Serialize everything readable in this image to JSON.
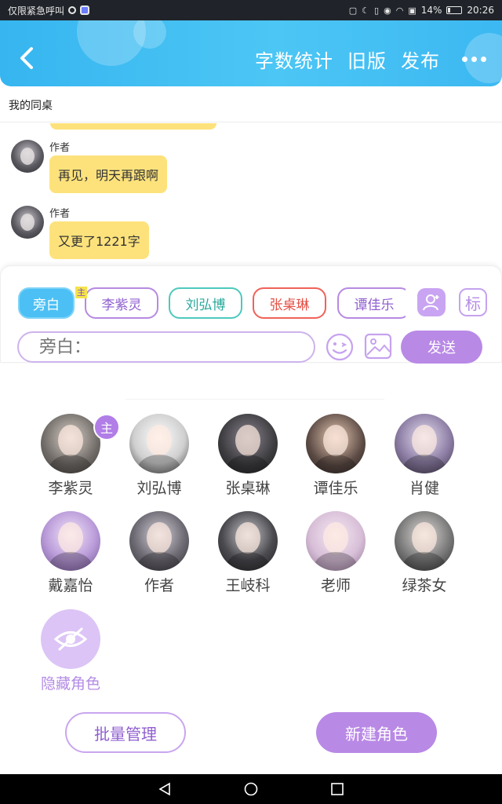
{
  "status_bar": {
    "left_text": "仅限紧急呼叫",
    "battery_text": "14%",
    "battery_level": 0.14,
    "time": "20:26"
  },
  "header": {
    "actions": [
      "字数统计",
      "旧版",
      "发布"
    ]
  },
  "chat": {
    "title": "我的同桌",
    "messages": [
      {
        "sender": "作者",
        "text": "再见，明天再跟啊"
      },
      {
        "sender": "作者",
        "text": "又更了1221字"
      }
    ]
  },
  "input": {
    "role_chips": [
      "旁白",
      "李紫灵",
      "刘弘博",
      "张桌琳",
      "谭佳乐"
    ],
    "host_mark": "主",
    "tag_label": "标",
    "placeholder": "旁白：",
    "send_label": "发送"
  },
  "characters": {
    "host_badge": "主",
    "items": [
      {
        "name": "李紫灵",
        "color": "#6f6a66"
      },
      {
        "name": "刘弘博",
        "color": "#cfcfcf"
      },
      {
        "name": "张桌琳",
        "color": "#3b3a3d"
      },
      {
        "name": "谭佳乐",
        "color": "#5b4a44"
      },
      {
        "name": "肖健",
        "color": "#8e7fa6"
      },
      {
        "name": "戴嘉怡",
        "color": "#b99ad8"
      },
      {
        "name": "作者",
        "color": "#6d6a73"
      },
      {
        "name": "王岐科",
        "color": "#4a4a4f"
      },
      {
        "name": "老师",
        "color": "#d8bfd8"
      },
      {
        "name": "绿茶女",
        "color": "#7a7a7a"
      }
    ],
    "hide_label": "隐藏角色"
  },
  "buttons": {
    "batch_manage": "批量管理",
    "new_role": "新建角色"
  },
  "colors": {
    "header_blue": "#3cb8f2",
    "bubble_yellow": "#fde27c",
    "accent_purple": "#b989e6"
  }
}
